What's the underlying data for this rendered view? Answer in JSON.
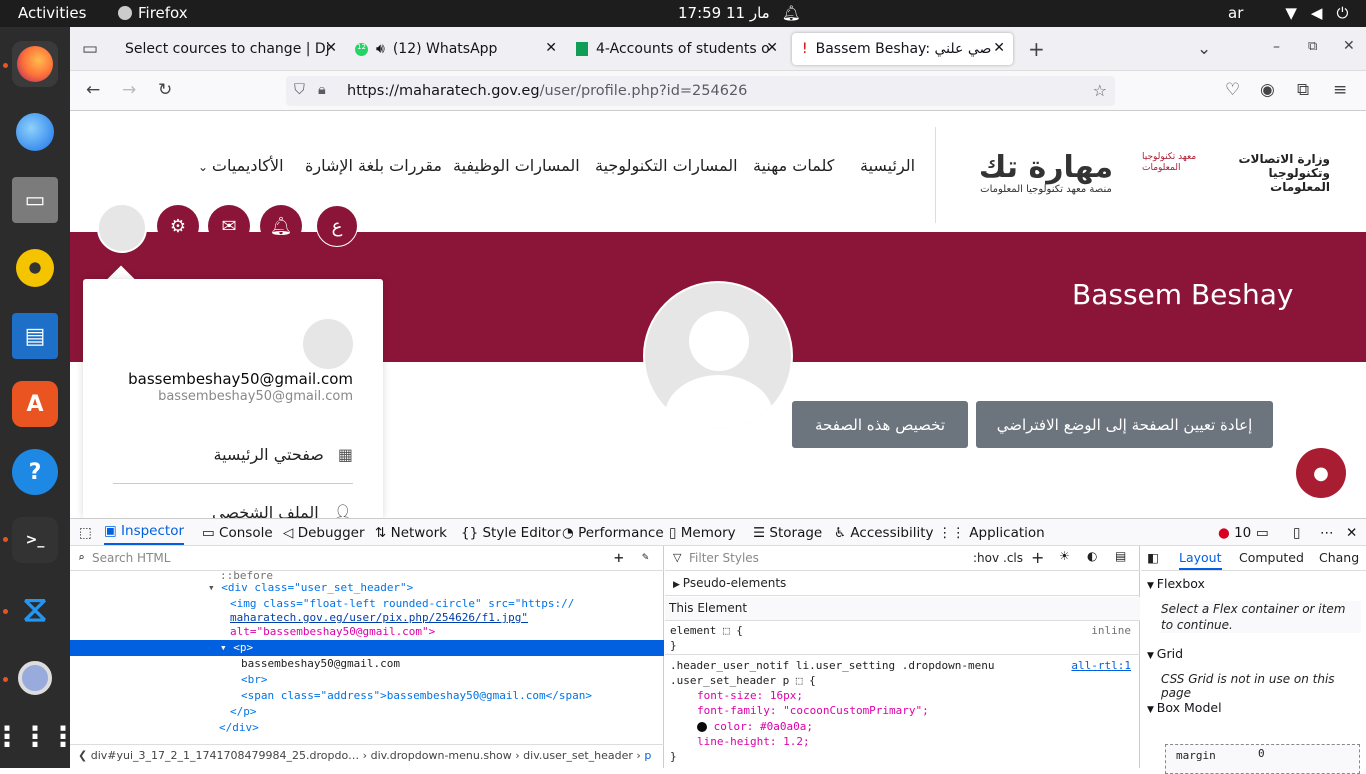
{
  "os": {
    "activities": "Activities",
    "app_name": "Firefox",
    "clock": "17:59  مار 11",
    "lang": "ar"
  },
  "browser": {
    "tabs": [
      {
        "title": "Select cources to change | Dj"
      },
      {
        "title": "(12) WhatsApp",
        "badge": "12"
      },
      {
        "title": "4-Accounts of students o"
      },
      {
        "title": "Bassem Beshay: صي علني"
      }
    ],
    "url_host": "https://maharatech.gov.eg",
    "url_path": "/user/profile.php?id=254626"
  },
  "site": {
    "logo_text": "مهارة تك",
    "logo_sub": "منصة معهد تكنولوجيا المعلومات",
    "iti_text": "معهد تكنولوجيا المعلومات",
    "ministry_text": "وزارة الاتصالات وتكنولوجيا المعلومات",
    "menu": [
      "الرئيسية",
      "كلمات مهنية",
      "المسارات التكنولوجية",
      "المسارات الوظيفية",
      "مقررات بلغة الإشارة",
      "الأكاديميات"
    ],
    "lang_button": "ع",
    "user_name": "Bassem Beshay",
    "reset_button": "إعادة تعيين الصفحة إلى الوضع الافتراضي",
    "customize_button": "تخصيص هذه الصفحة",
    "dropdown": {
      "email": "bassembeshay50@gmail.com",
      "address": "bassembeshay50@gmail.com",
      "home_item": "صفحتي الرئيسية",
      "profile_item": "الملف الشخصي"
    }
  },
  "devtools": {
    "tabs": [
      "Inspector",
      "Console",
      "Debugger",
      "Network",
      "Style Editor",
      "Performance",
      "Memory",
      "Storage",
      "Accessibility",
      "Application"
    ],
    "error_count": "10",
    "search_placeholder": "Search HTML",
    "filter_placeholder": "Filter Styles",
    "hov": ":hov",
    "cls": ".cls",
    "html_lines": {
      "before": "::before",
      "div_open": "<div class=\"user_set_header\">",
      "img1": "<img class=\"float-left rounded-circle\" src=\"https://",
      "img2": "maharatech.gov.eg/user/pix.php/254626/f1.jpg\"",
      "img3": "alt=\"bassembeshay50@gmail.com\">",
      "p_open": "<p>",
      "text": "bassembeshay50@gmail.com",
      "br": "<br>",
      "span": "<span class=\"address\">bassembeshay50@gmail.com</span>",
      "p_close": "</p>",
      "div_close": "</div>"
    },
    "breadcrumbs": [
      "div#yui_3_17_2_1_1741708479984_25.dropdo…",
      "div.dropdown-menu.show",
      "div.user_set_header",
      "p"
    ],
    "rules": {
      "pseudo": "Pseudo-elements",
      "this_element": "This Element",
      "element_rule": "element ⬚ {",
      "inline": "inline",
      "close": "}",
      "selector1": ".header_user_notif li.user_setting .dropdown-menu",
      "selector2": ".user_set_header p ⬚ {",
      "source": "all-rtl:1",
      "decl1": "font-size: 16px;",
      "decl2": "font-family: \"cocoonCustomPrimary\";",
      "decl3": "color: #0a0a0a;",
      "decl4": "line-height: 1.2;"
    },
    "layout": {
      "tabs": [
        "Layout",
        "Computed",
        "Chang"
      ],
      "flexbox": "Flexbox",
      "flex_msg": "Select a Flex container or item to continue.",
      "grid": "Grid",
      "grid_msg": "CSS Grid is not in use on this page",
      "boxmodel": "Box Model",
      "margin_label": "margin",
      "margin_value": "0"
    }
  },
  "colors": {
    "brand": "#8b1538",
    "accent": "#0060df"
  }
}
